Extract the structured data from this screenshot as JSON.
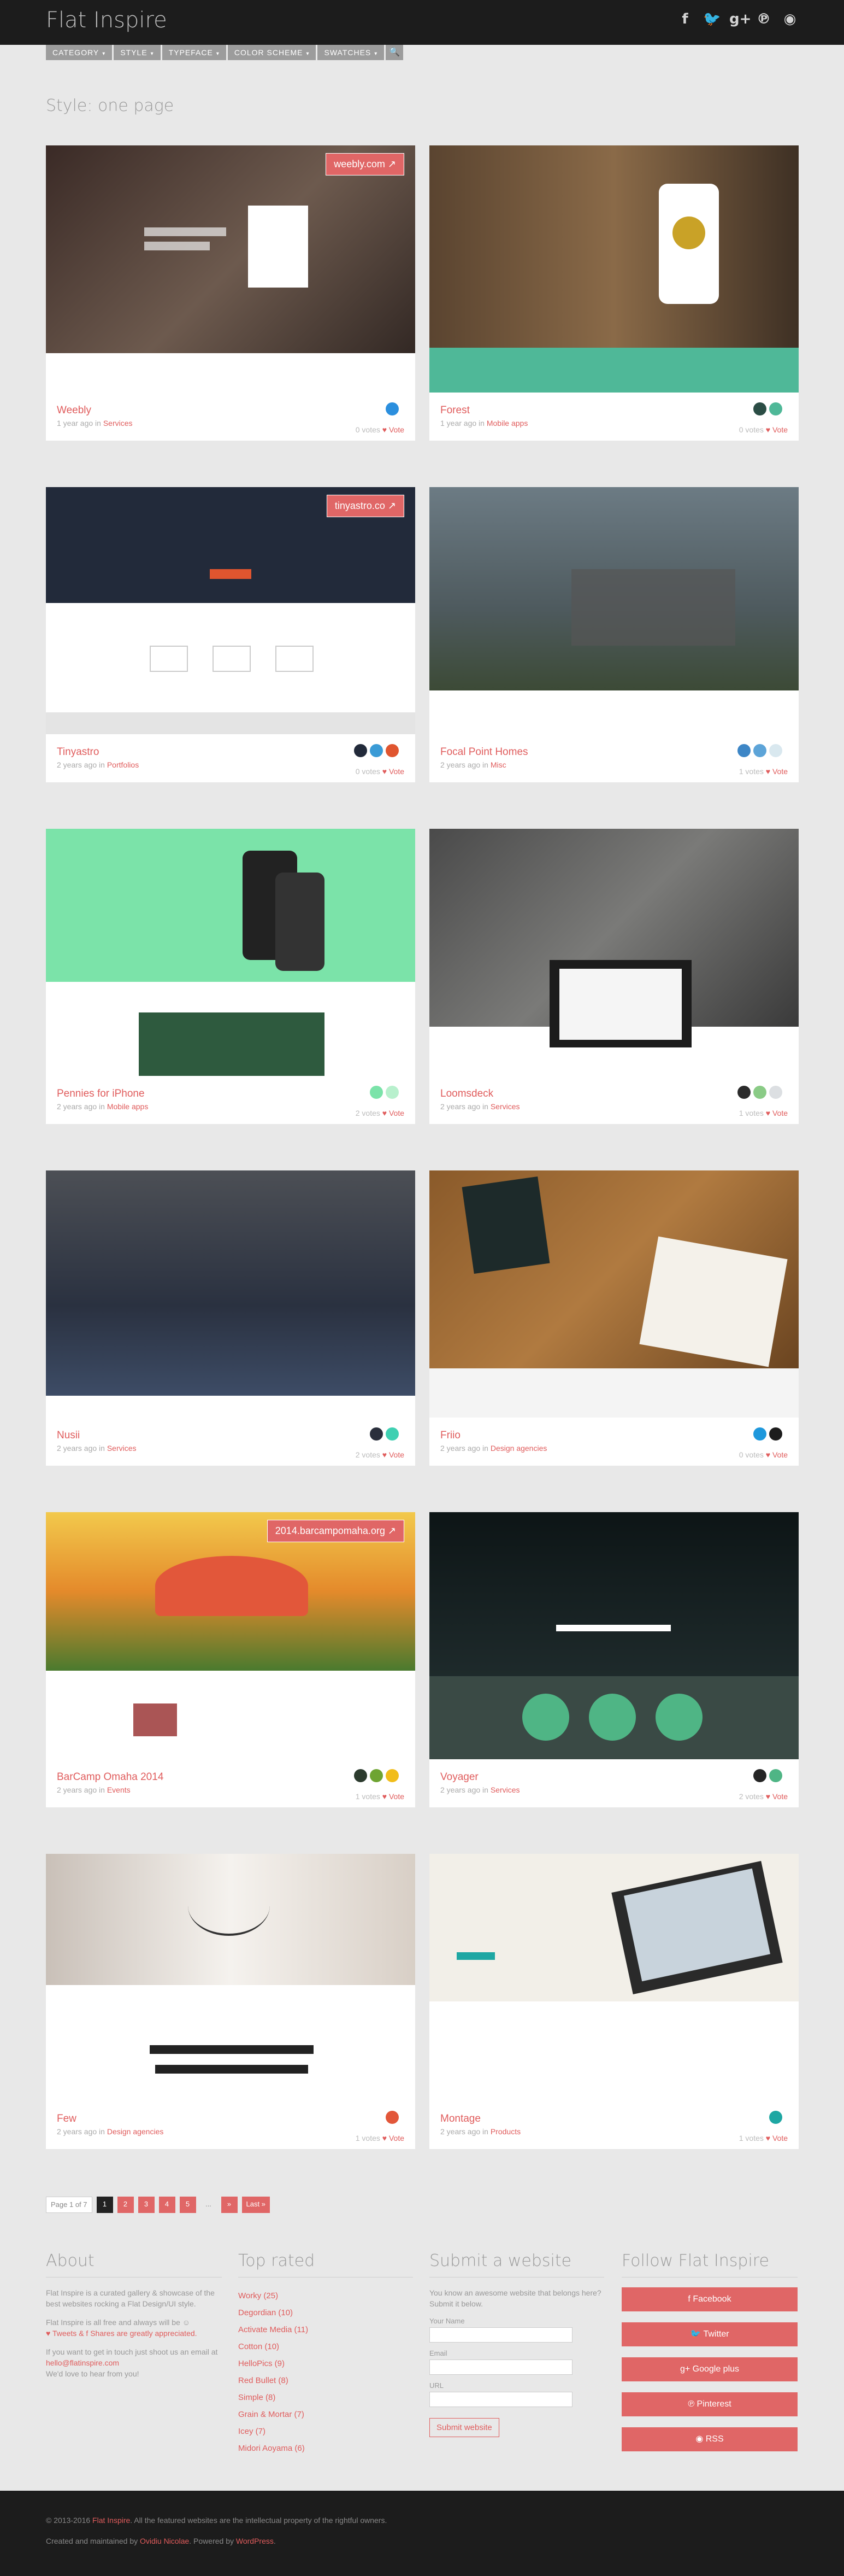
{
  "site": {
    "title": "Flat Inspire"
  },
  "social": [
    {
      "icon": "facebook-icon",
      "glyph": "f"
    },
    {
      "icon": "twitter-icon",
      "glyph": "🐦"
    },
    {
      "icon": "google-plus-icon",
      "glyph": "g+"
    },
    {
      "icon": "pinterest-icon",
      "glyph": "℗"
    },
    {
      "icon": "rss-icon",
      "glyph": "◉"
    }
  ],
  "menu": [
    {
      "label": "Category",
      "chevron": "▾"
    },
    {
      "label": "Style",
      "chevron": "▾"
    },
    {
      "label": "Typeface",
      "chevron": "▾"
    },
    {
      "label": "Color scheme",
      "chevron": "▾"
    },
    {
      "label": "Swatches",
      "chevron": "▾"
    }
  ],
  "search_glyph": "🔍",
  "page_title": "Style: one page",
  "cards": [
    {
      "title": "Weebly",
      "time": "1 year ago in",
      "category": "Services",
      "swatches": [
        "#2b8fde"
      ],
      "votes": "0 votes",
      "vote_label": "Vote",
      "visit": "weebly.com ↗",
      "thumb": "weebly"
    },
    {
      "title": "Forest",
      "time": "1 year ago in",
      "category": "Mobile apps",
      "swatches": [
        "#2b4d45",
        "#4fb898"
      ],
      "votes": "0 votes",
      "vote_label": "Vote",
      "visit": "",
      "thumb": "forest"
    },
    {
      "title": "Tinyastro",
      "time": "2 years ago in",
      "category": "Portfolios",
      "swatches": [
        "#222a3a",
        "#3a9bd6",
        "#e0552f"
      ],
      "votes": "0 votes",
      "vote_label": "Vote",
      "visit": "tinyastro.co ↗",
      "thumb": "tinyastro"
    },
    {
      "title": "Focal Point Homes",
      "time": "2 years ago in",
      "category": "Misc",
      "swatches": [
        "#3d86c6",
        "#5da4d8",
        "#d9e8ef"
      ],
      "votes": "1 votes",
      "vote_label": "Vote",
      "visit": "",
      "thumb": "focal"
    },
    {
      "title": "Pennies for iPhone",
      "time": "2 years ago in",
      "category": "Mobile apps",
      "swatches": [
        "#7be3a9",
        "#b8f0cd"
      ],
      "votes": "2 votes",
      "vote_label": "Vote",
      "visit": "",
      "thumb": "pennies"
    },
    {
      "title": "Loomsdeck",
      "time": "2 years ago in",
      "category": "Services",
      "swatches": [
        "#2b2b2b",
        "#8acb86",
        "#dcdfe2"
      ],
      "votes": "1 votes",
      "vote_label": "Vote",
      "visit": "",
      "thumb": "loomsdeck"
    },
    {
      "title": "Nusii",
      "time": "2 years ago in",
      "category": "Services",
      "swatches": [
        "#2a2f3c",
        "#3fd0b2"
      ],
      "votes": "2 votes",
      "vote_label": "Vote",
      "visit": "",
      "thumb": "nusii"
    },
    {
      "title": "Friio",
      "time": "2 years ago in",
      "category": "Design agencies",
      "swatches": [
        "#1e98dc",
        "#1c1c1c"
      ],
      "votes": "0 votes",
      "vote_label": "Vote",
      "visit": "",
      "thumb": "friio"
    },
    {
      "title": "BarCamp Omaha 2014",
      "time": "2 years ago in",
      "category": "Events",
      "swatches": [
        "#2c3b2e",
        "#6ea432",
        "#f1bd1a"
      ],
      "votes": "1 votes",
      "vote_label": "Vote",
      "visit": "2014.barcampomaha.org ↗",
      "thumb": "barcamp"
    },
    {
      "title": "Voyager",
      "time": "2 years ago in",
      "category": "Services",
      "swatches": [
        "#252525",
        "#4fb585"
      ],
      "votes": "2 votes",
      "vote_label": "Vote",
      "visit": "",
      "thumb": "voyager"
    },
    {
      "title": "Few",
      "time": "2 years ago in",
      "category": "Design agencies",
      "swatches": [
        "#e2573a"
      ],
      "votes": "1 votes",
      "vote_label": "Vote",
      "visit": "",
      "thumb": "few"
    },
    {
      "title": "Montage",
      "time": "2 years ago in",
      "category": "Products",
      "swatches": [
        "#1ea7a3"
      ],
      "votes": "1 votes",
      "vote_label": "Vote",
      "visit": "",
      "thumb": "montage"
    }
  ],
  "pagination": {
    "info": "Page 1 of 7",
    "pages": [
      "1",
      "2",
      "3",
      "4",
      "5"
    ],
    "dots": "...",
    "next": "»",
    "last": "Last »"
  },
  "footer": {
    "about": {
      "title": "About",
      "p1": "Flat Inspire is a curated gallery & showcase of the best websites rocking a Flat Design/UI style.",
      "p2a": "Flat Inspire is all free and always will be ☺",
      "p2b": "♥ Tweets & f Shares are greatly appreciated.",
      "p3a": "If you want to get in touch just shoot us an email at",
      "email": "hello@flatinspire.com",
      "p3b": "We'd love to hear from you!"
    },
    "top_rated": {
      "title": "Top rated",
      "items": [
        "Worky (25)",
        "Degordian (10)",
        "Activate Media (11)",
        "Cotton (10)",
        "HelloPics (9)",
        "Red Bullet (8)",
        "Simple (8)",
        "Grain & Mortar (7)",
        "Icey (7)",
        "Midori Aoyama (6)"
      ]
    },
    "submit": {
      "title": "Submit a website",
      "intro": "You know an awesome website that belongs here? Submit it below.",
      "name_label": "Your Name",
      "email_label": "Email",
      "url_label": "URL",
      "button": "Submit website"
    },
    "follow": {
      "title": "Follow Flat Inspire",
      "buttons": [
        "f Facebook",
        "🐦 Twitter",
        "g+ Google plus",
        "℗ Pinterest",
        "◉ RSS"
      ]
    }
  },
  "bottom": {
    "line1a": "© 2013-2016",
    "line1_link": "Flat Inspire",
    "line1b": ". All the featured websites are the intellectual property of the rightful owners.",
    "line2a": "Created and maintained by",
    "line2_link": "Ovidiu Nicolae",
    "line2b": ". Powered by",
    "line2_link2": "WordPress",
    "line2c": "."
  }
}
